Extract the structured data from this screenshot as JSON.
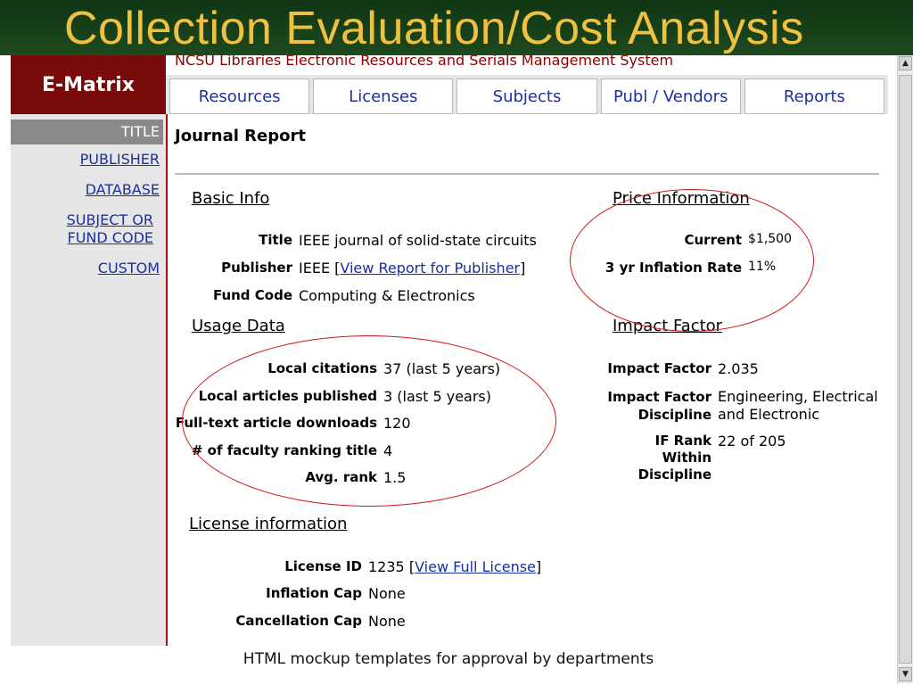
{
  "slide": {
    "title": "Collection Evaluation/Cost Analysis",
    "caption": "HTML mockup templates for approval by departments"
  },
  "header": {
    "brand": "E-Matrix",
    "banner": "NCSU Libraries Electronic Resources and Serials Management System"
  },
  "tabs": [
    "Resources",
    "Licenses",
    "Subjects",
    "Publ / Vendors",
    "Reports"
  ],
  "sidebar": {
    "active": "TITLE",
    "links": [
      "PUBLISHER",
      "DATABASE",
      "SUBJECT OR FUND CODE",
      "CUSTOM"
    ]
  },
  "report": {
    "title": "Journal Report",
    "basic_info": {
      "heading": "Basic Info",
      "title_label": "Title",
      "title_value": "IEEE journal of solid-state circuits",
      "publisher_label": "Publisher",
      "publisher_value": "IEEE",
      "publisher_bracket_open": "[",
      "publisher_link": "View Report for Publisher",
      "publisher_bracket_close": "]",
      "fund_label": "Fund Code",
      "fund_value": "Computing & Electronics"
    },
    "price_info": {
      "heading": "Price Information",
      "current_label": "Current",
      "current_value": "$1,500",
      "inflation_label": "3 yr Inflation Rate",
      "inflation_value": "11%"
    },
    "usage_data": {
      "heading": "Usage Data",
      "local_citations_label": "Local citations",
      "local_citations_value": "37 (last 5 years)",
      "local_articles_label": "Local articles published",
      "local_articles_value": "3 (last 5 years)",
      "downloads_label": "Full-text article downloads",
      "downloads_value": "120",
      "faculty_label": "# of faculty ranking title",
      "faculty_value": "4",
      "avg_rank_label": "Avg. rank",
      "avg_rank_value": "1.5"
    },
    "impact_factor": {
      "heading": "Impact Factor",
      "factor_label": "Impact Factor",
      "factor_value": "2.035",
      "discipline_label_1": "Impact Factor",
      "discipline_label_2": "Discipline",
      "discipline_value_1": "Engineering, Electrical",
      "discipline_value_2": "and Electronic",
      "rank_label_1": "IF Rank",
      "rank_label_2": "Within",
      "rank_label_3": "Discipline",
      "rank_value": "22 of 205"
    },
    "license_info": {
      "heading": "License information",
      "license_label": "License ID",
      "license_value": "1235",
      "license_bracket_open": "[",
      "license_link": "View Full License",
      "license_bracket_close": "]",
      "inflation_cap_label": "Inflation Cap",
      "inflation_cap_value": "None",
      "cancellation_cap_label": "Cancellation Cap",
      "cancellation_cap_value": "None"
    }
  },
  "colors": {
    "title_gold": "#f0c040",
    "slide_green": "#1e4a1f",
    "brand_maroon": "#7a0b0b",
    "link_blue": "#1a2fa0",
    "annotation_red": "#d01818"
  },
  "icons": {
    "scroll_up": "scroll-up-arrow-icon",
    "scroll_down": "scroll-down-arrow-icon"
  }
}
